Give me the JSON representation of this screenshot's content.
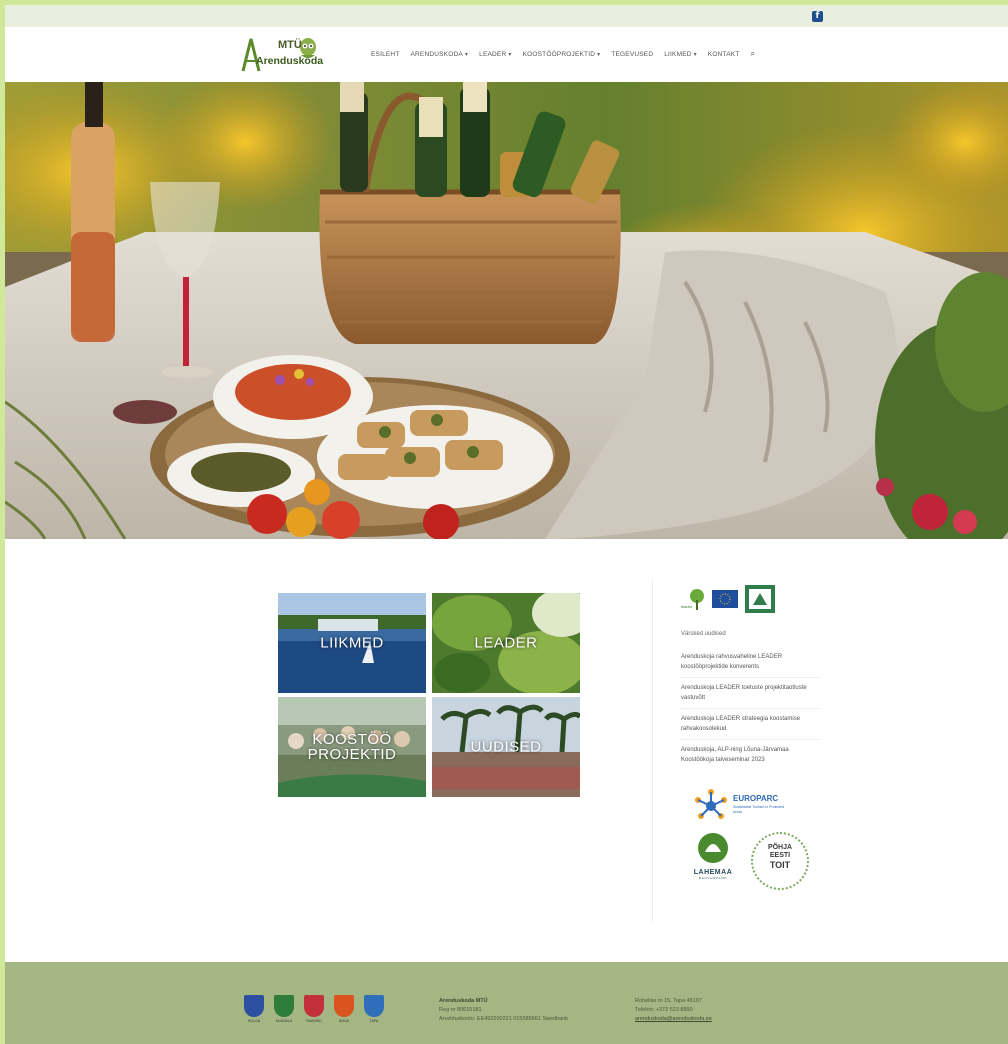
{
  "topbar": {
    "social_icon": "facebook-icon"
  },
  "header": {
    "logo_line1": "MTÜ",
    "logo_line2": "Arenduskoda",
    "nav": [
      {
        "label": "ESILEHT",
        "has_dropdown": false
      },
      {
        "label": "ARENDUSKODA",
        "has_dropdown": true
      },
      {
        "label": "LEADER",
        "has_dropdown": true
      },
      {
        "label": "KOOSTÖÖPROJEKTID",
        "has_dropdown": true
      },
      {
        "label": "TEGEVUSED",
        "has_dropdown": false
      },
      {
        "label": "LIIKMED",
        "has_dropdown": true
      },
      {
        "label": "KONTAKT",
        "has_dropdown": false
      }
    ],
    "chevron_glyph": "▾",
    "search_glyph": "⌕"
  },
  "tiles": [
    {
      "label": "LIIKMED"
    },
    {
      "label": "LEADER"
    },
    {
      "label": "KOOSTÖÖ PROJEKTID"
    },
    {
      "label": "UUDISED"
    }
  ],
  "sidebar": {
    "title": "Värsked uudised",
    "news": [
      "Arenduskoja rahvusvaheline LEADER koostööprojektide konverents",
      "Arenduskoja LEADER toetuste projektitaotluste vastuvõtt",
      "Arenduskoja LEADER strateegia koostamise rahvakoosolekud",
      "Arenduskoja, ALP-ning Lõuna-Järvamaa Koostöökoja talveseminar 2023"
    ],
    "europarc_title": "EUROPARC",
    "europarc_sub": "Sustainable Tourism in Protected Areas",
    "lahemaa_label": "LAHEMAA",
    "lahemaa_sub": "RAHVUSPARK",
    "pohja_line1": "PÕHJA",
    "pohja_line2": "EESTI",
    "pohja_line3": "TOIT",
    "leader_text": "leader"
  },
  "footer": {
    "crests": [
      {
        "label": "KOLGA",
        "color": "#2c4fa0"
      },
      {
        "label": "KUUSALU",
        "color": "#2f7d3a"
      },
      {
        "label": "RAASIKU",
        "color": "#c3303a"
      },
      {
        "label": "ANIJA",
        "color": "#d9541e"
      },
      {
        "label": "TAPA",
        "color": "#2f6eb8"
      }
    ],
    "org_name": "Arenduskoda MTÜ",
    "reg_code": "Reg nr 80615181",
    "bank": "Arvelduskonto: EE492200221 015585961 Swedbank",
    "address": "Rohelise tn 15, Tapa 45107",
    "phone": "Telefon: +372 523 8890",
    "email": "arenduskoda@arenduskoda.ee"
  },
  "colors": {
    "outer_bg": "#cfe89a",
    "topbar_bg": "#e9eedf",
    "footer_bg": "#a3b683",
    "facebook": "#1f4e8c"
  }
}
